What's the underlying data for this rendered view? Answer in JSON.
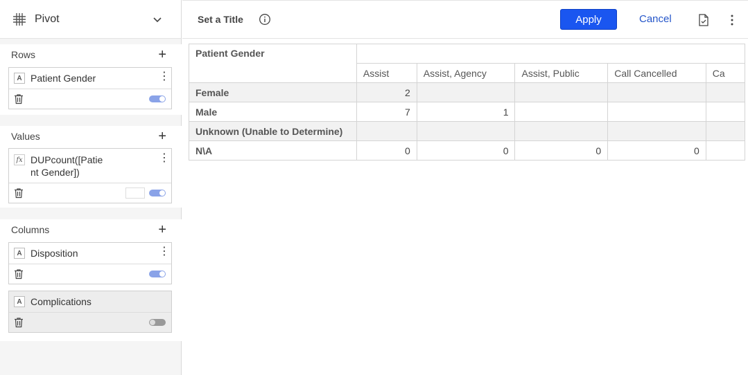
{
  "sidebar": {
    "title": "Pivot",
    "rows": {
      "label": "Rows",
      "fields": [
        {
          "type_icon": "A",
          "name": "Patient Gender",
          "toggle": "on"
        }
      ]
    },
    "values": {
      "label": "Values",
      "fields": [
        {
          "type_icon": "fx",
          "name_line1": "DUPcount([Patie",
          "name_line2": "nt Gender])",
          "toggle": "on"
        }
      ]
    },
    "columns": {
      "label": "Columns",
      "fields": [
        {
          "type_icon": "A",
          "name": "Disposition",
          "toggle": "on"
        },
        {
          "type_icon": "A",
          "name": "Complications",
          "toggle": "off"
        }
      ]
    }
  },
  "topbar": {
    "title": "Set a Title",
    "apply_label": "Apply",
    "cancel_label": "Cancel"
  },
  "pivot": {
    "row_header": "Patient Gender",
    "columns": [
      "Assist",
      "Assist, Agency",
      "Assist, Public",
      "Call Cancelled",
      "Ca"
    ],
    "rows": [
      {
        "label": "Female",
        "values": [
          "2",
          "",
          "",
          "",
          ""
        ]
      },
      {
        "label": "Male",
        "values": [
          "7",
          "1",
          "",
          "",
          ""
        ]
      },
      {
        "label": "Unknown (Unable to Determine)",
        "values": [
          "",
          "",
          "",
          "",
          ""
        ]
      },
      {
        "label": "N\\A",
        "values": [
          "0",
          "0",
          "0",
          "0",
          ""
        ]
      }
    ]
  },
  "colors": {
    "accent": "#1a56f0",
    "link": "#2455c9",
    "toggle_on": "#8aa3e8"
  }
}
